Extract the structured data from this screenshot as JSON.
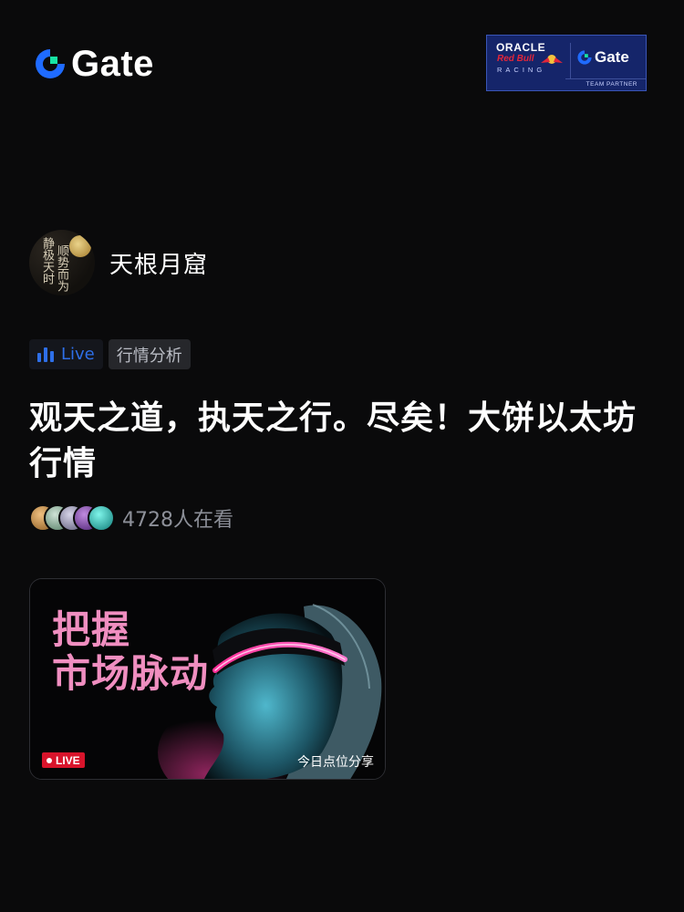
{
  "brand": {
    "name": "Gate",
    "icon": "gate-logo-icon",
    "accent": "#1f6bff",
    "green": "#17e3a4"
  },
  "partner": {
    "oracle": "ORACLE",
    "redbull": "Red Bull",
    "racing": "RACING",
    "gate": "Gate",
    "team": "TEAM PARTNER",
    "bg": "#15256a"
  },
  "host": {
    "name": "天根月窟",
    "avatar_text": [
      "静极天时",
      "顺势而为"
    ]
  },
  "tags": {
    "live": "Live",
    "category": "行情分析"
  },
  "title": "观天之道，执天之行。尽矣！大饼以太坊行情",
  "viewers": {
    "count_text": "4728人在看",
    "face_colors": [
      "#c9893a",
      "#7fa88e",
      "#8f8da8",
      "#7a4aa0",
      "#1fb8b0"
    ]
  },
  "thumbnail": {
    "headline_1": "把握",
    "headline_2": "市场脉动",
    "badge": "LIVE",
    "caption": "今日点位分享",
    "neon": "#ff3fa4"
  }
}
